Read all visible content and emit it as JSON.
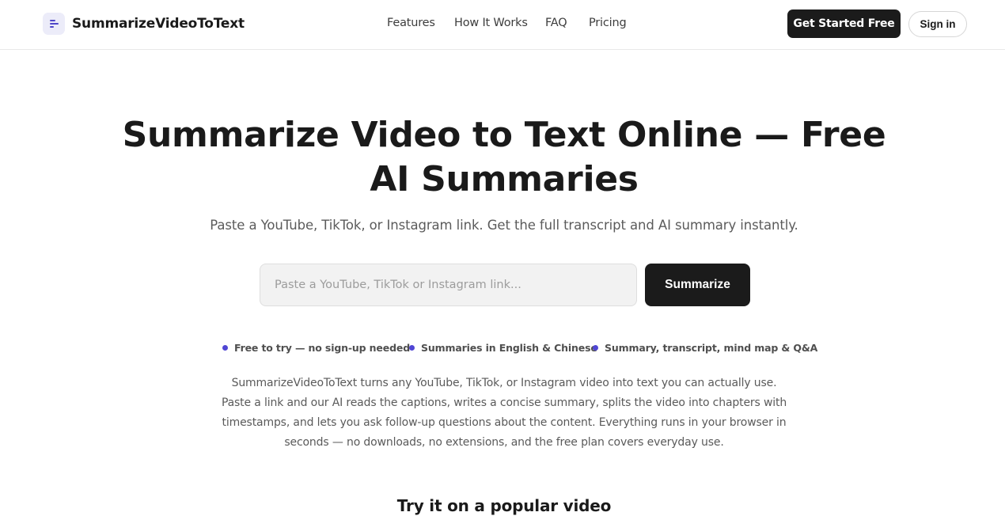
{
  "header": {
    "brand": "SummarizeVideoToText",
    "nav": [
      "Features",
      "How It Works",
      "FAQ",
      "Pricing"
    ],
    "cta_primary": "Get Started Free",
    "cta_secondary": "Sign in"
  },
  "hero": {
    "title_line1": "Summarize Video to Text Online — Free",
    "title_line2": "AI Summaries",
    "subtitle": "Paste a YouTube, TikTok, or Instagram link. Get the full transcript and AI summary instantly."
  },
  "search": {
    "placeholder": "Paste a YouTube, TikTok or Instagram link...",
    "value": "",
    "button_label": "Summarize"
  },
  "features": [
    "Free to try — no sign-up needed",
    "Summaries in English & Chinese",
    "Summary, transcript, mind map & Q&A"
  ],
  "description": "SummarizeVideoToText turns any YouTube, TikTok, or Instagram video into text you can actually use. Paste a link and our AI reads the captions, writes a concise summary, splits the video into chapters with timestamps, and lets you ask follow-up questions about the content. Everything runs in your browser in seconds — no downloads, no extensions, and the free plan covers everyday use.",
  "popular_heading": "Try it on a popular video",
  "colors": {
    "accent": "#5046d4",
    "dark_button": "#1b1b1b",
    "brand_icon_bg": "#ececf9"
  },
  "icons": {
    "brand": "summary-lines-icon",
    "feature_bullet": "dot-icon"
  }
}
